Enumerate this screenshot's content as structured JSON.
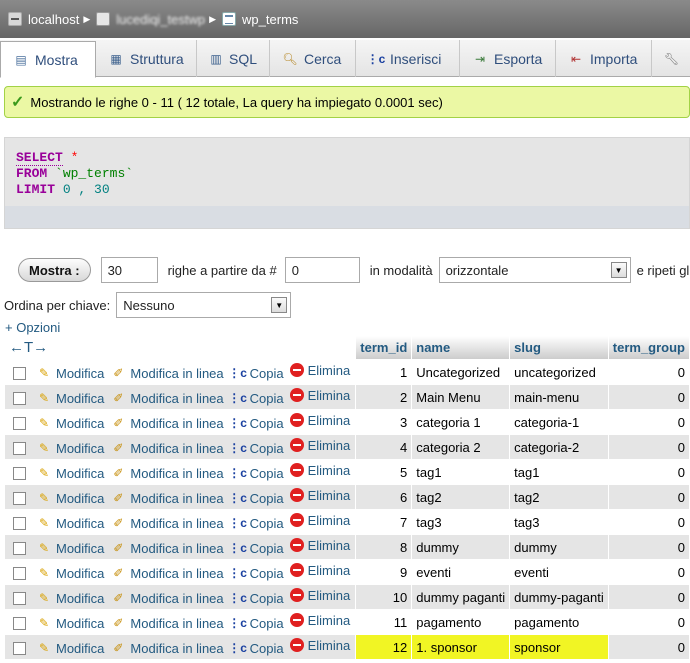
{
  "breadcrumb": {
    "server": "localhost",
    "database": "lucediqi_testwp",
    "table": "wp_terms"
  },
  "tabs": [
    {
      "label": "Mostra",
      "icon": "browse-icon",
      "active": true
    },
    {
      "label": "Struttura",
      "icon": "structure-icon"
    },
    {
      "label": "SQL",
      "icon": "sql-icon"
    },
    {
      "label": "Cerca",
      "icon": "search-icon"
    },
    {
      "label": "Inserisci",
      "icon": "insert-icon"
    },
    {
      "label": "Esporta",
      "icon": "export-icon"
    },
    {
      "label": "Importa",
      "icon": "import-icon"
    },
    {
      "label": "",
      "icon": "operations-icon"
    }
  ],
  "message": "Mostrando le righe 0 - 11 ( 12 totale, La query ha impiegato 0.0001 sec)",
  "sql": {
    "select": "SELECT",
    "star": "*",
    "from": "FROM",
    "table": "`wp_terms`",
    "limit": "LIMIT",
    "limit_values": "0 , 30"
  },
  "nav": {
    "button": "Mostra :",
    "rows": "30",
    "from_label": "righe a partire da #",
    "start": "0",
    "mode_label": "in modalità",
    "mode": "orizzontale",
    "repeat_label": "e ripeti gli"
  },
  "sort": {
    "label": "Ordina per chiave:",
    "value": "Nessuno"
  },
  "options_link": "+ Opzioni",
  "column_arrows": "←T→",
  "actions": {
    "edit": "Modifica",
    "inline": "Modifica in linea",
    "copy": "Copia",
    "delete": "Elimina"
  },
  "columns": [
    "term_id",
    "name",
    "slug",
    "term_group"
  ],
  "rows": [
    {
      "term_id": "1",
      "name": "Uncategorized",
      "slug": "uncategorized",
      "term_group": "0"
    },
    {
      "term_id": "2",
      "name": "Main Menu",
      "slug": "main-menu",
      "term_group": "0"
    },
    {
      "term_id": "3",
      "name": "categoria 1",
      "slug": "categoria-1",
      "term_group": "0"
    },
    {
      "term_id": "4",
      "name": "categoria 2",
      "slug": "categoria-2",
      "term_group": "0"
    },
    {
      "term_id": "5",
      "name": "tag1",
      "slug": "tag1",
      "term_group": "0"
    },
    {
      "term_id": "6",
      "name": "tag2",
      "slug": "tag2",
      "term_group": "0"
    },
    {
      "term_id": "7",
      "name": "tag3",
      "slug": "tag3",
      "term_group": "0"
    },
    {
      "term_id": "8",
      "name": "dummy",
      "slug": "dummy",
      "term_group": "0"
    },
    {
      "term_id": "9",
      "name": "eventi",
      "slug": "eventi",
      "term_group": "0"
    },
    {
      "term_id": "10",
      "name": "dummy paganti",
      "slug": "dummy-paganti",
      "term_group": "0"
    },
    {
      "term_id": "11",
      "name": "pagamento",
      "slug": "pagamento",
      "term_group": "0"
    },
    {
      "term_id": "12",
      "name": "1. sponsor",
      "slug": "sponsor",
      "term_group": "0",
      "highlighted": true
    }
  ],
  "colors": {
    "link": "#235a81",
    "success_bg": "#ebf8a4",
    "highlight": "#f1f524"
  }
}
